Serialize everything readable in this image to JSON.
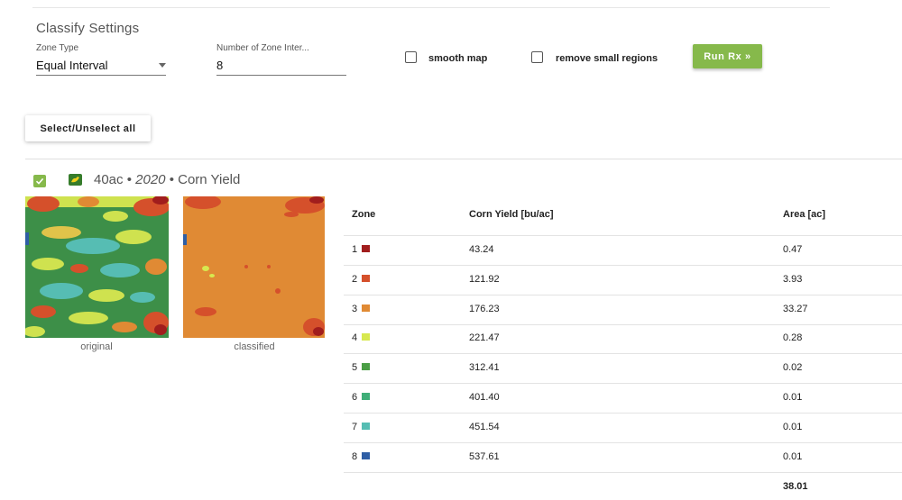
{
  "settings": {
    "title": "Classify Settings",
    "zone_type_label": "Zone Type",
    "zone_type_value": "Equal Interval",
    "zone_count_label": "Number of Zone Inter...",
    "zone_count_value": "8",
    "smooth_map_label": "smooth map",
    "remove_small_label": "remove small regions",
    "run_label": "Run Rx »"
  },
  "select_all_label": "Select/Unselect all",
  "layer": {
    "size": "40ac",
    "sep1": "•",
    "year": "2020",
    "sep2": "•",
    "name": "Corn Yield",
    "original_caption": "original",
    "classified_caption": "classified"
  },
  "table": {
    "headers": {
      "zone": "Zone",
      "yield": "Corn Yield [bu/ac]",
      "area": "Area [ac]"
    },
    "rows": [
      {
        "zone": "1",
        "color": "#a11d1d",
        "yield": "43.24",
        "area": "0.47"
      },
      {
        "zone": "2",
        "color": "#d5502b",
        "yield": "121.92",
        "area": "3.93"
      },
      {
        "zone": "3",
        "color": "#e08a34",
        "yield": "176.23",
        "area": "33.27"
      },
      {
        "zone": "4",
        "color": "#d7e84f",
        "yield": "221.47",
        "area": "0.28"
      },
      {
        "zone": "5",
        "color": "#4a9e45",
        "yield": "312.41",
        "area": "0.02"
      },
      {
        "zone": "6",
        "color": "#3fae78",
        "yield": "401.40",
        "area": "0.01"
      },
      {
        "zone": "7",
        "color": "#56bdb3",
        "yield": "451.54",
        "area": "0.01"
      },
      {
        "zone": "8",
        "color": "#2e5ea5",
        "yield": "537.61",
        "area": "0.01"
      }
    ],
    "total_area": "38.01"
  }
}
